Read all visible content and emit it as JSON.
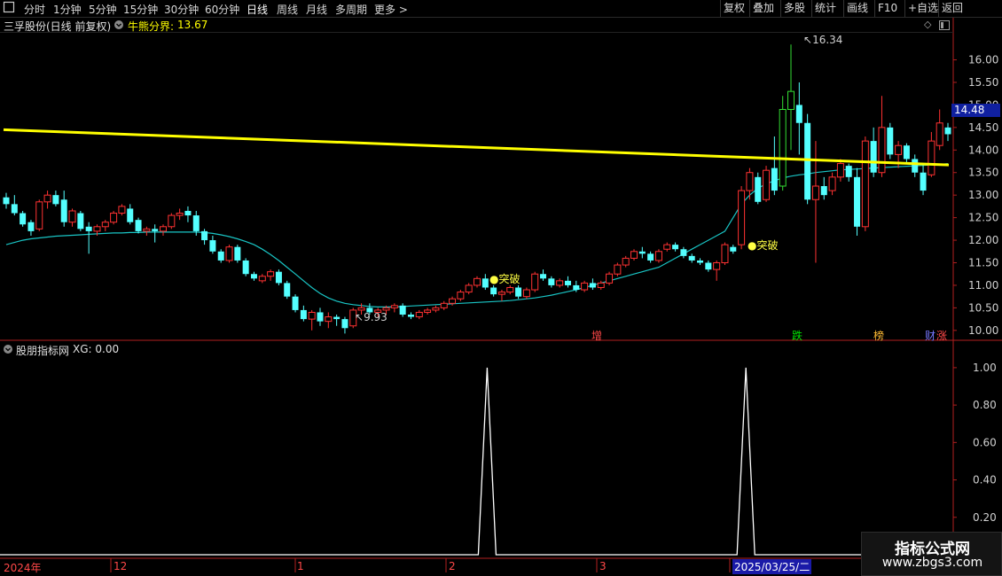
{
  "toolbar": {
    "left_icon": "stop-square-icon",
    "periods": [
      "分时",
      "1分钟",
      "5分钟",
      "15分钟",
      "30分钟",
      "60分钟",
      "日线",
      "周线",
      "月线",
      "多周期"
    ],
    "active_period": "日线",
    "more": "更多",
    "right_buttons": [
      "复权",
      "叠加",
      "多股",
      "统计",
      "画线",
      "F10",
      "+自选",
      "返回"
    ]
  },
  "main_panel": {
    "stock_title": "三孚股份(日线 前复权)",
    "indicator_label": "牛熊分界:",
    "indicator_value": "13.67",
    "high_label": "16.34",
    "low_label": "9.93",
    "last_price": "14.48",
    "signal_labels": [
      "突破",
      "突破"
    ],
    "event_tags": [
      "增",
      "跌",
      "榜",
      "财",
      "涨"
    ]
  },
  "sub_panel": {
    "title": "股朋指标网",
    "indicator_label": "XG: 0.00"
  },
  "x_axis_labels": [
    "2024年",
    "12",
    "1",
    "2",
    "3",
    "2025/03/25/二"
  ],
  "watermark": {
    "line1": "指标公式网",
    "line2": "www.zbgs3.com"
  },
  "colors": {
    "up": "#ff3232",
    "down": "#54ffff",
    "bull_bear_line": "#ffff00",
    "ma_line": "#19c4c4",
    "axis": "#b21f1f",
    "xg_line": "#ffffff",
    "tag_red": "#ff4848",
    "tag_green": "#00e000",
    "tag_orange": "#ffbb33",
    "tag_blue": "#7777ff"
  },
  "chart_data": [
    {
      "type": "candlestick",
      "title": "三孚股份(日线 前复权)",
      "y_ticks": [
        10.0,
        10.5,
        11.0,
        11.5,
        12.0,
        12.5,
        13.0,
        13.5,
        14.0,
        14.5,
        15.0,
        15.5,
        16.0
      ],
      "ylim": [
        9.8,
        16.6
      ],
      "bull_bear_line": {
        "name": "牛熊分界",
        "start": 14.45,
        "end": 13.67
      },
      "high_marker": 16.34,
      "low_marker": 9.93,
      "candles_ohlc": [
        [
          12.95,
          13.05,
          12.7,
          12.8
        ],
        [
          12.8,
          13.0,
          12.55,
          12.6
        ],
        [
          12.6,
          12.65,
          12.3,
          12.35
        ],
        [
          12.4,
          12.45,
          12.1,
          12.2
        ],
        [
          12.25,
          12.9,
          12.2,
          12.85
        ],
        [
          12.85,
          13.1,
          12.7,
          13.0
        ],
        [
          13.0,
          13.1,
          12.75,
          12.8
        ],
        [
          12.9,
          13.1,
          12.3,
          12.4
        ],
        [
          12.4,
          12.7,
          12.3,
          12.65
        ],
        [
          12.6,
          12.65,
          12.2,
          12.25
        ],
        [
          12.3,
          12.4,
          11.7,
          12.2
        ],
        [
          12.2,
          12.35,
          12.1,
          12.3
        ],
        [
          12.3,
          12.45,
          12.2,
          12.4
        ],
        [
          12.4,
          12.65,
          12.35,
          12.6
        ],
        [
          12.6,
          12.8,
          12.55,
          12.75
        ],
        [
          12.7,
          12.8,
          12.35,
          12.4
        ],
        [
          12.45,
          12.5,
          12.15,
          12.2
        ],
        [
          12.2,
          12.3,
          12.1,
          12.25
        ],
        [
          12.25,
          12.35,
          11.95,
          12.2
        ],
        [
          12.2,
          12.35,
          12.1,
          12.3
        ],
        [
          12.3,
          12.6,
          12.25,
          12.55
        ],
        [
          12.55,
          12.7,
          12.45,
          12.6
        ],
        [
          12.65,
          12.75,
          12.4,
          12.55
        ],
        [
          12.55,
          12.65,
          12.1,
          12.2
        ],
        [
          12.2,
          12.25,
          11.9,
          12.0
        ],
        [
          12.0,
          12.1,
          11.7,
          11.75
        ],
        [
          11.75,
          11.8,
          11.5,
          11.55
        ],
        [
          11.55,
          11.9,
          11.5,
          11.85
        ],
        [
          11.85,
          11.9,
          11.5,
          11.55
        ],
        [
          11.55,
          11.6,
          11.2,
          11.25
        ],
        [
          11.25,
          11.3,
          11.1,
          11.15
        ],
        [
          11.1,
          11.25,
          11.05,
          11.2
        ],
        [
          11.2,
          11.35,
          11.1,
          11.3
        ],
        [
          11.3,
          11.35,
          11.0,
          11.05
        ],
        [
          11.05,
          11.1,
          10.7,
          10.75
        ],
        [
          10.75,
          10.8,
          10.4,
          10.45
        ],
        [
          10.45,
          10.55,
          10.2,
          10.25
        ],
        [
          10.25,
          10.45,
          10.0,
          10.4
        ],
        [
          10.4,
          10.5,
          10.1,
          10.2
        ],
        [
          10.2,
          10.4,
          10.05,
          10.3
        ],
        [
          10.3,
          10.35,
          10.1,
          10.25
        ],
        [
          10.25,
          10.3,
          9.93,
          10.05
        ],
        [
          10.1,
          10.5,
          10.05,
          10.45
        ],
        [
          10.45,
          10.6,
          10.35,
          10.5
        ],
        [
          10.5,
          10.6,
          10.35,
          10.4
        ],
        [
          10.4,
          10.5,
          10.3,
          10.45
        ],
        [
          10.45,
          10.55,
          10.35,
          10.5
        ],
        [
          10.5,
          10.6,
          10.4,
          10.55
        ],
        [
          10.55,
          10.6,
          10.3,
          10.35
        ],
        [
          10.35,
          10.4,
          10.25,
          10.3
        ],
        [
          10.3,
          10.45,
          10.25,
          10.4
        ],
        [
          10.4,
          10.5,
          10.35,
          10.45
        ],
        [
          10.45,
          10.55,
          10.4,
          10.5
        ],
        [
          10.5,
          10.65,
          10.45,
          10.6
        ],
        [
          10.6,
          10.75,
          10.55,
          10.7
        ],
        [
          10.7,
          10.9,
          10.65,
          10.85
        ],
        [
          10.85,
          11.05,
          10.8,
          11.0
        ],
        [
          11.0,
          11.2,
          10.95,
          11.15
        ],
        [
          11.15,
          11.25,
          10.9,
          10.95
        ],
        [
          10.95,
          11.0,
          10.75,
          10.8
        ],
        [
          10.8,
          10.9,
          10.65,
          10.85
        ],
        [
          10.85,
          11.0,
          10.8,
          10.95
        ],
        [
          10.95,
          11.0,
          10.7,
          10.75
        ],
        [
          10.75,
          10.95,
          10.7,
          10.9
        ],
        [
          10.9,
          11.3,
          10.85,
          11.25
        ],
        [
          11.25,
          11.35,
          11.1,
          11.15
        ],
        [
          11.15,
          11.2,
          10.95,
          11.0
        ],
        [
          11.0,
          11.15,
          10.95,
          11.1
        ],
        [
          11.1,
          11.2,
          10.95,
          11.0
        ],
        [
          11.0,
          11.1,
          10.85,
          10.9
        ],
        [
          10.9,
          11.1,
          10.85,
          11.05
        ],
        [
          11.05,
          11.15,
          10.9,
          10.95
        ],
        [
          10.95,
          11.1,
          10.9,
          11.05
        ],
        [
          11.05,
          11.3,
          11.0,
          11.25
        ],
        [
          11.25,
          11.5,
          11.2,
          11.45
        ],
        [
          11.45,
          11.65,
          11.4,
          11.6
        ],
        [
          11.6,
          11.8,
          11.55,
          11.75
        ],
        [
          11.75,
          11.85,
          11.6,
          11.7
        ],
        [
          11.7,
          11.75,
          11.5,
          11.55
        ],
        [
          11.55,
          11.8,
          11.5,
          11.75
        ],
        [
          11.8,
          11.95,
          11.75,
          11.9
        ],
        [
          11.9,
          11.95,
          11.75,
          11.8
        ],
        [
          11.8,
          11.85,
          11.6,
          11.65
        ],
        [
          11.65,
          11.7,
          11.5,
          11.55
        ],
        [
          11.55,
          11.6,
          11.45,
          11.5
        ],
        [
          11.5,
          11.55,
          11.3,
          11.35
        ],
        [
          11.35,
          11.55,
          11.1,
          11.5
        ],
        [
          11.5,
          11.95,
          11.45,
          11.9
        ],
        [
          11.85,
          11.9,
          11.7,
          11.75
        ],
        [
          11.9,
          13.2,
          11.8,
          13.1
        ],
        [
          13.1,
          13.6,
          12.9,
          13.5
        ],
        [
          13.4,
          13.5,
          12.8,
          12.85
        ],
        [
          12.9,
          13.65,
          12.85,
          13.55
        ],
        [
          13.6,
          14.3,
          13.0,
          13.1
        ],
        [
          13.2,
          15.2,
          13.1,
          14.9
        ],
        [
          14.9,
          16.34,
          14.0,
          15.3
        ],
        [
          15.0,
          15.5,
          13.9,
          14.6
        ],
        [
          14.6,
          14.8,
          12.8,
          12.9
        ],
        [
          12.9,
          14.2,
          11.5,
          13.2
        ],
        [
          13.2,
          13.4,
          12.9,
          13.0
        ],
        [
          13.1,
          13.5,
          13.0,
          13.4
        ],
        [
          13.4,
          13.8,
          13.3,
          13.7
        ],
        [
          13.65,
          13.7,
          13.3,
          13.4
        ],
        [
          13.4,
          13.6,
          12.1,
          12.3
        ],
        [
          12.3,
          14.3,
          12.2,
          14.2
        ],
        [
          14.2,
          14.5,
          13.4,
          13.5
        ],
        [
          13.5,
          15.2,
          13.4,
          14.5
        ],
        [
          14.5,
          14.6,
          13.8,
          13.9
        ],
        [
          13.9,
          14.2,
          13.6,
          14.1
        ],
        [
          14.1,
          14.15,
          13.7,
          13.8
        ],
        [
          13.8,
          13.9,
          13.4,
          13.5
        ],
        [
          13.5,
          13.7,
          13.0,
          13.1
        ],
        [
          13.45,
          14.4,
          13.4,
          14.2
        ],
        [
          14.1,
          14.9,
          14.0,
          14.6
        ],
        [
          14.5,
          14.6,
          14.2,
          14.35
        ]
      ],
      "ma_series": [
        11.9,
        11.95,
        12.0,
        12.03,
        12.05,
        12.07,
        12.09,
        12.1,
        12.11,
        12.12,
        12.13,
        12.14,
        12.15,
        12.16,
        12.16,
        12.17,
        12.17,
        12.18,
        12.18,
        12.18,
        12.18,
        12.18,
        12.18,
        12.18,
        12.17,
        12.15,
        12.12,
        12.08,
        12.03,
        11.97,
        11.9,
        11.8,
        11.68,
        11.55,
        11.4,
        11.25,
        11.1,
        10.95,
        10.82,
        10.72,
        10.65,
        10.6,
        10.57,
        10.55,
        10.53,
        10.52,
        10.52,
        10.52,
        10.53,
        10.54,
        10.55,
        10.56,
        10.57,
        10.58,
        10.59,
        10.6,
        10.61,
        10.62,
        10.63,
        10.64,
        10.65,
        10.66,
        10.68,
        10.7,
        10.72,
        10.75,
        10.78,
        10.82,
        10.86,
        10.9,
        10.95,
        11.0,
        11.05,
        11.1,
        11.15,
        11.2,
        11.25,
        11.3,
        11.35,
        11.4,
        11.5,
        11.6,
        11.7,
        11.8,
        11.9,
        12.0,
        12.1,
        12.2,
        12.5,
        12.8,
        13.0,
        13.15,
        13.25,
        13.32,
        13.38,
        13.42,
        13.45,
        13.47,
        13.5,
        13.52,
        13.54,
        13.56,
        13.57,
        13.58,
        13.59,
        13.6,
        13.61,
        13.62,
        13.63,
        13.64,
        13.65,
        13.66,
        13.67,
        13.68,
        13.7
      ],
      "signals": [
        {
          "label": "突破",
          "value": 11.05
        },
        {
          "label": "突破",
          "value": 11.7
        }
      ]
    },
    {
      "type": "line",
      "title": "股朋指标网",
      "series": [
        {
          "name": "XG",
          "peaks": [
            {
              "position": 0.512,
              "value": 1.0
            },
            {
              "position": 0.784,
              "value": 1.0
            }
          ]
        }
      ],
      "y_ticks": [
        0.2,
        0.4,
        0.6,
        0.8,
        1.0
      ],
      "ylim": [
        0,
        1.08
      ],
      "current_value": 0.0
    }
  ]
}
